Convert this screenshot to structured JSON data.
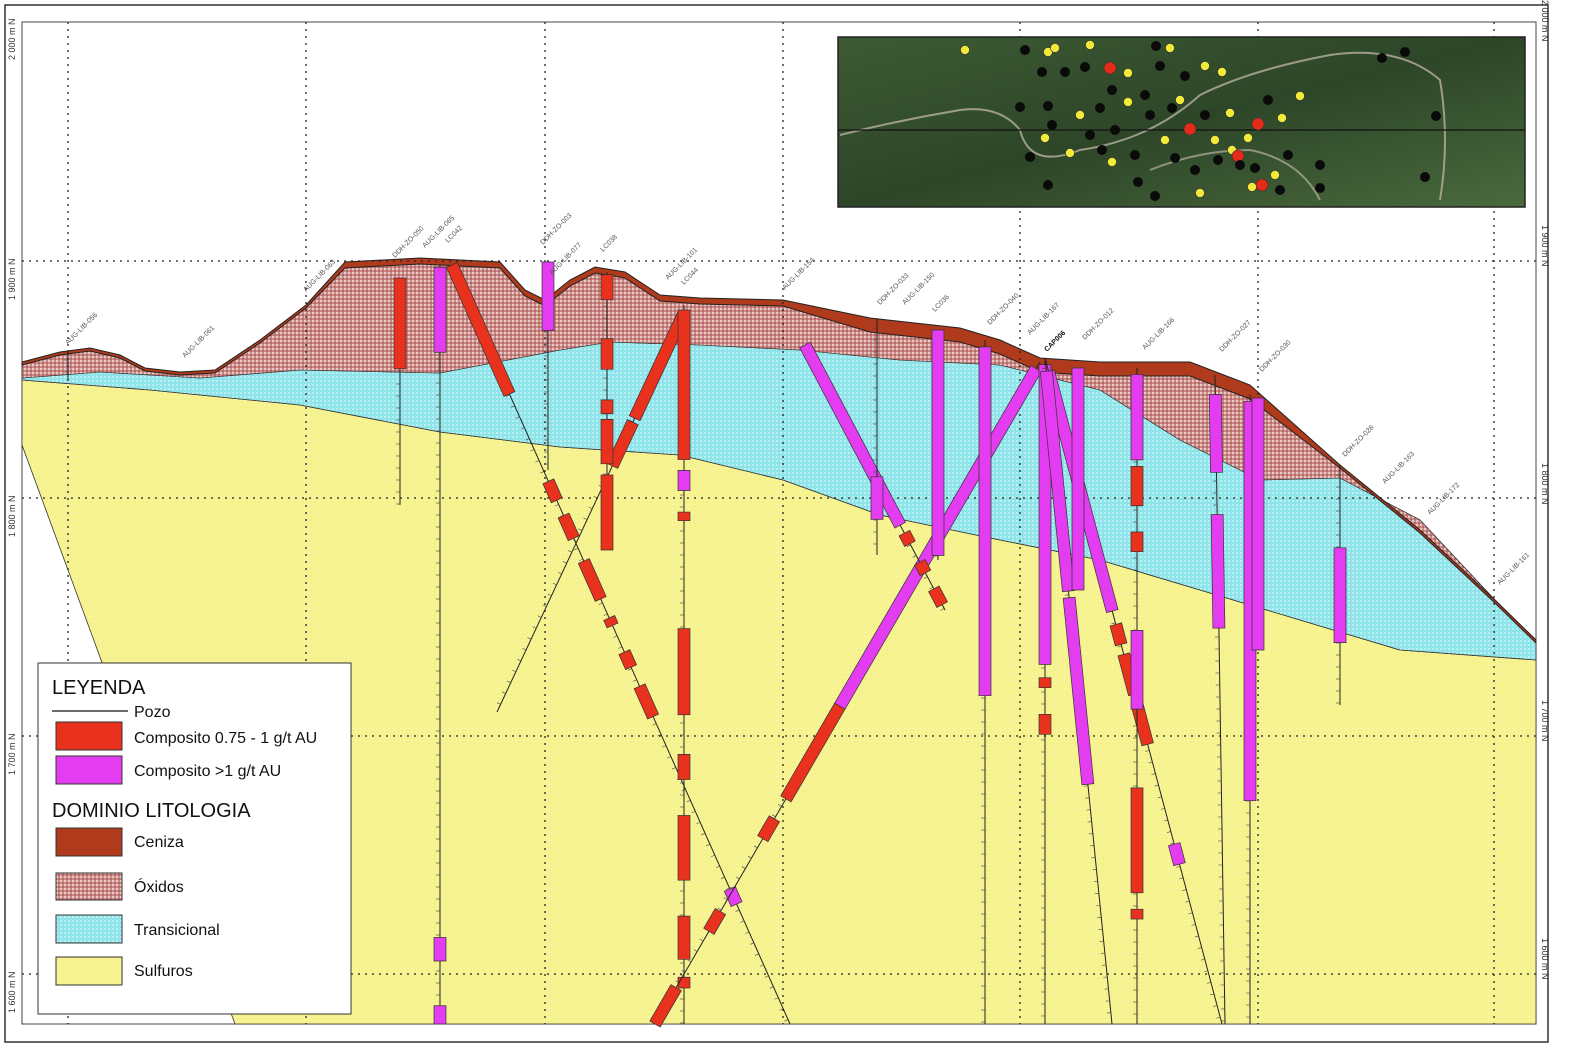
{
  "axis": {
    "elevations": [
      "2 000 m N",
      "1 900 m N",
      "1 800 m N",
      "1 700 m N",
      "1 600 m N"
    ]
  },
  "legend": {
    "title": "LEYENDA",
    "well": "Pozo",
    "composites": [
      {
        "label": "Composito 0.75 - 1 g/t AU",
        "color": "#e8321e"
      },
      {
        "label": "Composito >1 g/t AU",
        "color": "#e43cf0"
      }
    ],
    "lithology_title": "DOMINIO LITOLOGIA",
    "lithology": [
      {
        "label": "Ceniza",
        "color": "#b03a1c"
      },
      {
        "label": "Óxidos",
        "color": "#c98a88"
      },
      {
        "label": "Transicional",
        "color": "#8fe4ea"
      },
      {
        "label": "Sulfuros",
        "color": "#f6f38e"
      }
    ]
  },
  "holes": [
    "AUG-LIB-056",
    "AUG-LIB-061",
    "AUG-LIB-063",
    "DDH-ZO-050",
    "AUG-LIB-065",
    "LC042",
    "DDH-ZO-003",
    "AUG-LIB-077",
    "LC038",
    "AUG-LIB-101",
    "LC044",
    "AUG-LIB-154",
    "DDH-ZO-033",
    "AUG-LIB-150",
    "LC036",
    "DDH-ZO-040",
    "AUG-LIB-167",
    "CAP006",
    "DDH-ZO-012",
    "AUG-LIB-166",
    "DDH-ZO-027",
    "DDH-ZO-030",
    "DDH-ZO-028",
    "AUG-LIB-163",
    "AUG-LIB-172",
    "AUG-LIB-161"
  ]
}
